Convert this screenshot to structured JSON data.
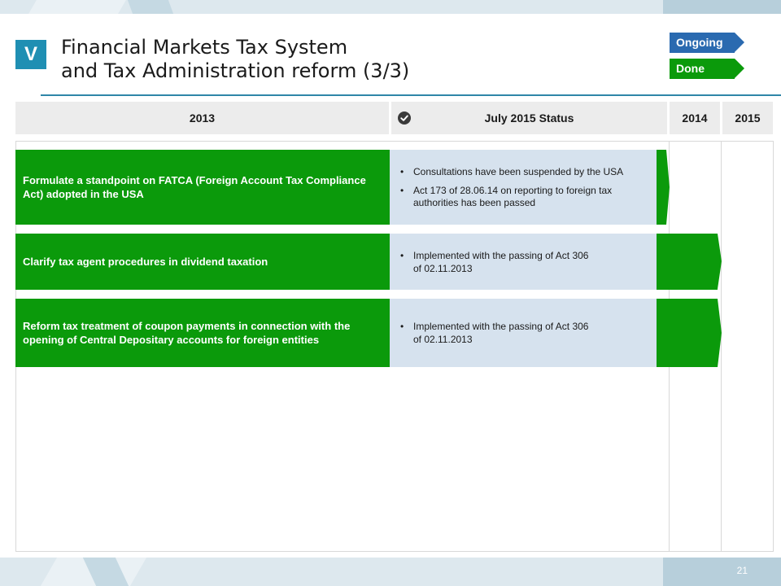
{
  "header": {
    "section_badge": "V",
    "title_line1": "Financial Markets Tax System",
    "title_line2": "and Tax Administration reform (3/3)"
  },
  "legend": {
    "ongoing": "Ongoing",
    "done": "Done",
    "colors": {
      "ongoing": "#2a6ab0",
      "done": "#0b9a0b"
    }
  },
  "columns": {
    "year_start": "2013",
    "status": "July 2015 Status",
    "status_icon": "check-circle-icon",
    "year_mid": "2014",
    "year_end": "2015"
  },
  "rows": [
    {
      "label": "Formulate a standpoint on FATCA (Foreign Account Tax Compliance Act) adopted in the USA",
      "status": [
        "Consultations have been suspended by the USA",
        "Act 173 of 28.06.14 on reporting to foreign tax authorities has been passed"
      ],
      "progress": "Done"
    },
    {
      "label": "Clarify tax agent procedures in dividend taxation",
      "status": [
        "Implemented with the passing of Act 306 of 02.11.2013"
      ],
      "progress": "Done"
    },
    {
      "label": "Reform tax treatment of coupon payments in connection with the opening of Central Depositary accounts for foreign entities",
      "status": [
        "Implemented with the passing of Act 306 of 02.11.2013"
      ],
      "progress": "Done"
    }
  ],
  "footer": {
    "page_number": "21"
  }
}
